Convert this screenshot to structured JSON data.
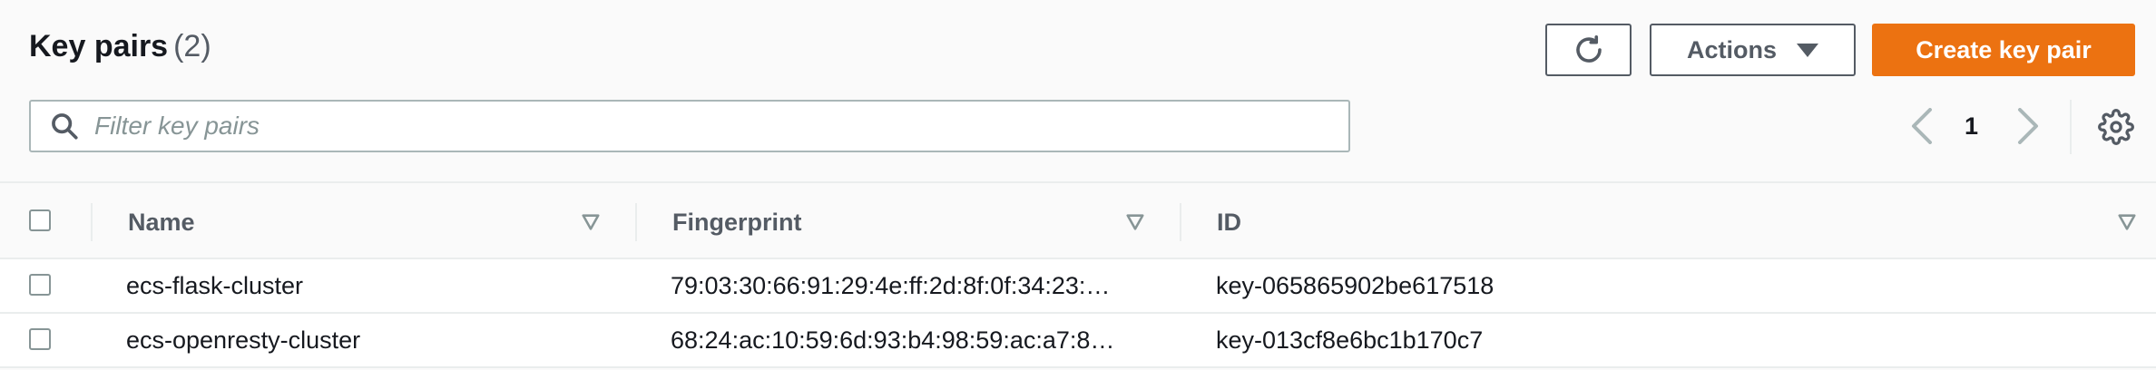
{
  "header": {
    "title": "Key pairs",
    "count": "(2)"
  },
  "toolbar": {
    "actions_label": "Actions",
    "create_label": "Create key pair"
  },
  "search": {
    "placeholder": "Filter key pairs",
    "value": ""
  },
  "pagination": {
    "current_page": "1"
  },
  "table": {
    "columns": [
      "Name",
      "Fingerprint",
      "ID"
    ],
    "rows": [
      {
        "name": "ecs-flask-cluster",
        "fingerprint": "79:03:30:66:91:29:4e:ff:2d:8f:0f:34:23:…",
        "id": "key-065865902be617518"
      },
      {
        "name": "ecs-openresty-cluster",
        "fingerprint": "68:24:ac:10:59:6d:93:b4:98:59:ac:a7:8…",
        "id": "key-013cf8e6bc1b170c7"
      }
    ]
  },
  "colors": {
    "accent": "#ec7211",
    "text": "#16191f",
    "muted": "#545b64"
  },
  "icons": [
    "refresh-icon",
    "caret-down-icon",
    "search-icon",
    "chevron-left-icon",
    "chevron-right-icon",
    "gear-icon",
    "sort-icon"
  ]
}
